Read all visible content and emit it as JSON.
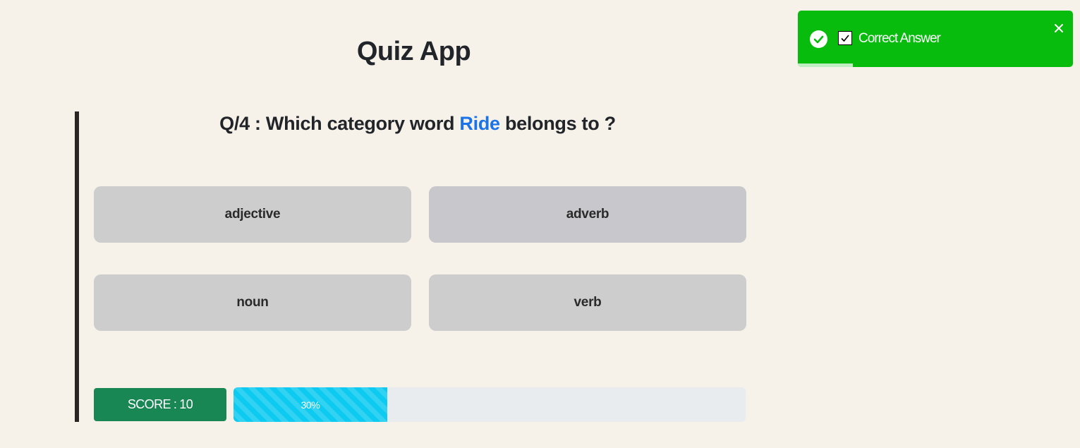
{
  "app": {
    "title": "Quiz App"
  },
  "question": {
    "prefix": "Q/4 : Which category word",
    "word": "Ride",
    "suffix": "belongs to ?",
    "word_color": "#1a73e8"
  },
  "options": [
    {
      "label": "adjective"
    },
    {
      "label": "adverb"
    },
    {
      "label": "noun"
    },
    {
      "label": "verb"
    }
  ],
  "score": {
    "label": "SCORE",
    "separator": ":",
    "value": "10",
    "color": "#198754"
  },
  "progress": {
    "value": 30,
    "label": "30%",
    "color": "#0dcaf0"
  },
  "toast": {
    "message": "Correct Answer",
    "type": "success",
    "icon": "check-circle-icon",
    "checkbox_icon": "checkbox-checked-icon",
    "close_icon": "close-icon",
    "color": "#07bc0c",
    "timer_remaining": 0.2
  }
}
